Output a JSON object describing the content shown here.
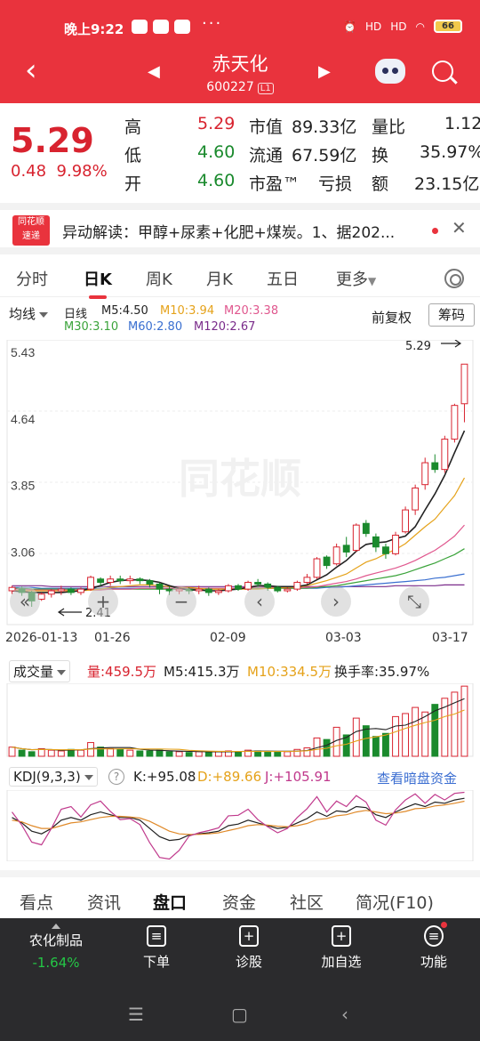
{
  "status_bar": {
    "time": "晚上9:22",
    "battery": "66",
    "signal_labels": [
      "HD",
      "HD"
    ]
  },
  "header": {
    "title": "赤天化",
    "code": "600227",
    "level": "L1"
  },
  "quote": {
    "price": "5.29",
    "change": "0.48",
    "change_pct": "9.98%",
    "rows": [
      {
        "k1": "高",
        "v1": "5.29",
        "k2": "市值",
        "v2": "89.33亿",
        "k3": "量比",
        "v3": "1.12"
      },
      {
        "k1": "低",
        "v1": "4.60",
        "k2": "流通",
        "v2": "67.59亿",
        "k3": "换",
        "v3": "35.97%"
      },
      {
        "k1": "开",
        "v1": "4.60",
        "k2": "市盈™",
        "v2": "亏损",
        "k3": "额",
        "v3": "23.15亿"
      }
    ],
    "colors": {
      "up": "#d8232f",
      "down": "#1a8a2d"
    }
  },
  "news": {
    "logo_top": "同花顺",
    "logo_bottom": "速递",
    "text": "异动解读：甲醇+尿素+化肥+煤炭。1、据202..."
  },
  "tabs": [
    "分时",
    "日K",
    "周K",
    "月K",
    "五日",
    "更多"
  ],
  "active_tab": "日K",
  "ma_legend": {
    "indicator": "均线",
    "period": "日线",
    "items": [
      {
        "label": "M5:4.50",
        "color": "#222222"
      },
      {
        "label": "M10:3.94",
        "color": "#e5a21a"
      },
      {
        "label": "M20:3.38",
        "color": "#e0578e"
      },
      {
        "label": "M30:3.10",
        "color": "#3aa33a"
      },
      {
        "label": "M60:2.80",
        "color": "#3a6fd0"
      },
      {
        "label": "M120:2.67",
        "color": "#7a2b8a"
      }
    ],
    "adjust": "前复权",
    "chip_button": "筹码"
  },
  "kline": {
    "watermark": "同花顺",
    "y_ticks": [
      "5.43",
      "4.64",
      "3.85",
      "3.06"
    ],
    "high_label": "5.29",
    "low_label": "2.41",
    "x_labels": [
      "2026-01-13",
      "01-26",
      "02-09",
      "03-03",
      "03-17"
    ]
  },
  "volume": {
    "name": "成交量",
    "vol": "量:459.5万",
    "m5": "M5:415.3万",
    "m10": "M10:334.5万",
    "turnover": "换手率:35.97%"
  },
  "kdj": {
    "name": "KDJ(9,3,3)",
    "help": "?",
    "k": "K:+95.08",
    "d": "D:+89.66",
    "j": "J:+105.91",
    "link": "查看暗盘资金"
  },
  "bottom_tabs": [
    "看点",
    "资讯",
    "盘口",
    "资金",
    "社区",
    "简况(F10)"
  ],
  "active_bottom_tab": "盘口",
  "dock": {
    "sector_name": "农化制品",
    "sector_pct": "-1.64%",
    "items": [
      {
        "label": "下单",
        "icon": "order-icon"
      },
      {
        "label": "诊股",
        "icon": "diagnose-icon"
      },
      {
        "label": "加自选",
        "icon": "add-watch-icon"
      },
      {
        "label": "功能",
        "icon": "menu-icon"
      }
    ]
  },
  "chart_data": [
    {
      "type": "candlestick",
      "title": "",
      "ylim": [
        2.41,
        5.43
      ],
      "y_ticks": [
        5.43,
        4.64,
        3.85,
        3.06
      ],
      "x_labels": [
        "2026-01-13",
        "01-26",
        "02-09",
        "03-03",
        "03-17"
      ],
      "candles": [
        [
          2.6,
          2.64,
          2.56,
          2.66
        ],
        [
          2.62,
          2.58,
          2.54,
          2.65
        ],
        [
          2.58,
          2.48,
          2.41,
          2.6
        ],
        [
          2.5,
          2.56,
          2.48,
          2.58
        ],
        [
          2.56,
          2.6,
          2.52,
          2.62
        ],
        [
          2.6,
          2.62,
          2.55,
          2.66
        ],
        [
          2.62,
          2.58,
          2.55,
          2.64
        ],
        [
          2.58,
          2.62,
          2.55,
          2.64
        ],
        [
          2.62,
          2.76,
          2.6,
          2.78
        ],
        [
          2.74,
          2.7,
          2.66,
          2.76
        ],
        [
          2.7,
          2.74,
          2.66,
          2.78
        ],
        [
          2.74,
          2.72,
          2.68,
          2.78
        ],
        [
          2.72,
          2.74,
          2.68,
          2.78
        ],
        [
          2.74,
          2.72,
          2.68,
          2.76
        ],
        [
          2.72,
          2.68,
          2.64,
          2.74
        ],
        [
          2.68,
          2.62,
          2.56,
          2.7
        ],
        [
          2.62,
          2.6,
          2.55,
          2.65
        ],
        [
          2.6,
          2.62,
          2.56,
          2.64
        ],
        [
          2.62,
          2.6,
          2.56,
          2.64
        ],
        [
          2.6,
          2.62,
          2.56,
          2.66
        ],
        [
          2.62,
          2.58,
          2.54,
          2.64
        ],
        [
          2.58,
          2.6,
          2.55,
          2.62
        ],
        [
          2.6,
          2.66,
          2.58,
          2.68
        ],
        [
          2.66,
          2.62,
          2.6,
          2.68
        ],
        [
          2.62,
          2.7,
          2.6,
          2.72
        ],
        [
          2.7,
          2.68,
          2.64,
          2.74
        ],
        [
          2.68,
          2.64,
          2.6,
          2.7
        ],
        [
          2.64,
          2.6,
          2.58,
          2.66
        ],
        [
          2.6,
          2.62,
          2.58,
          2.64
        ],
        [
          2.62,
          2.7,
          2.6,
          2.72
        ],
        [
          2.7,
          2.76,
          2.68,
          2.8
        ],
        [
          2.76,
          2.98,
          2.74,
          3.0
        ],
        [
          3.0,
          2.9,
          2.86,
          3.02
        ],
        [
          2.92,
          3.12,
          2.9,
          3.16
        ],
        [
          3.14,
          3.06,
          3.0,
          3.24
        ],
        [
          3.08,
          3.38,
          3.06,
          3.4
        ],
        [
          3.4,
          3.28,
          3.24,
          3.44
        ],
        [
          3.24,
          3.12,
          3.06,
          3.28
        ],
        [
          3.12,
          3.04,
          2.98,
          3.16
        ],
        [
          3.04,
          3.26,
          3.02,
          3.3
        ],
        [
          3.3,
          3.56,
          3.28,
          3.6
        ],
        [
          3.56,
          3.82,
          3.5,
          3.86
        ],
        [
          3.86,
          4.12,
          3.8,
          4.18
        ],
        [
          4.12,
          4.04,
          4.0,
          4.22
        ],
        [
          4.04,
          4.4,
          4.0,
          4.44
        ],
        [
          4.4,
          4.8,
          4.36,
          4.82
        ],
        [
          4.82,
          5.29,
          4.6,
          5.29
        ]
      ],
      "ma": {
        "M5": [
          2.6,
          2.59,
          2.58,
          2.58,
          2.58,
          2.58,
          2.59,
          2.6,
          2.63,
          2.66,
          2.7,
          2.72,
          2.73,
          2.73,
          2.72,
          2.7,
          2.66,
          2.63,
          2.61,
          2.61,
          2.6,
          2.6,
          2.61,
          2.62,
          2.64,
          2.66,
          2.66,
          2.65,
          2.65,
          2.65,
          2.67,
          2.73,
          2.79,
          2.88,
          2.96,
          3.07,
          3.15,
          3.17,
          3.18,
          3.22,
          3.25,
          3.36,
          3.56,
          3.75,
          3.97,
          4.24,
          4.5
        ],
        "M10": [
          2.61,
          2.6,
          2.6,
          2.6,
          2.6,
          2.6,
          2.6,
          2.6,
          2.61,
          2.62,
          2.64,
          2.65,
          2.66,
          2.67,
          2.67,
          2.66,
          2.65,
          2.64,
          2.64,
          2.63,
          2.62,
          2.62,
          2.62,
          2.62,
          2.62,
          2.62,
          2.63,
          2.63,
          2.64,
          2.64,
          2.66,
          2.69,
          2.72,
          2.76,
          2.8,
          2.87,
          2.94,
          2.98,
          3.04,
          3.09,
          3.16,
          3.26,
          3.36,
          3.45,
          3.59,
          3.73,
          3.94
        ],
        "M20": [
          2.62,
          2.62,
          2.61,
          2.61,
          2.61,
          2.61,
          2.61,
          2.61,
          2.61,
          2.61,
          2.62,
          2.62,
          2.62,
          2.63,
          2.63,
          2.63,
          2.63,
          2.63,
          2.63,
          2.63,
          2.63,
          2.63,
          2.63,
          2.63,
          2.64,
          2.64,
          2.64,
          2.64,
          2.64,
          2.64,
          2.64,
          2.65,
          2.67,
          2.69,
          2.71,
          2.74,
          2.78,
          2.81,
          2.84,
          2.87,
          2.91,
          2.96,
          3.02,
          3.08,
          3.16,
          3.25,
          3.38
        ],
        "M30": [
          2.63,
          2.63,
          2.62,
          2.62,
          2.62,
          2.62,
          2.62,
          2.62,
          2.62,
          2.62,
          2.62,
          2.62,
          2.62,
          2.62,
          2.62,
          2.62,
          2.62,
          2.62,
          2.62,
          2.62,
          2.62,
          2.62,
          2.62,
          2.62,
          2.63,
          2.63,
          2.63,
          2.63,
          2.63,
          2.63,
          2.63,
          2.64,
          2.65,
          2.66,
          2.68,
          2.7,
          2.72,
          2.74,
          2.76,
          2.78,
          2.81,
          2.85,
          2.89,
          2.93,
          2.98,
          3.03,
          3.1
        ],
        "M60": [
          2.64,
          2.64,
          2.64,
          2.63,
          2.63,
          2.63,
          2.63,
          2.63,
          2.63,
          2.63,
          2.63,
          2.63,
          2.63,
          2.63,
          2.63,
          2.63,
          2.63,
          2.63,
          2.63,
          2.63,
          2.63,
          2.63,
          2.63,
          2.63,
          2.63,
          2.63,
          2.63,
          2.63,
          2.63,
          2.63,
          2.63,
          2.63,
          2.64,
          2.64,
          2.65,
          2.66,
          2.67,
          2.68,
          2.69,
          2.7,
          2.71,
          2.72,
          2.73,
          2.75,
          2.76,
          2.78,
          2.8
        ],
        "M120": [
          2.66,
          2.66,
          2.66,
          2.66,
          2.65,
          2.65,
          2.65,
          2.65,
          2.65,
          2.65,
          2.65,
          2.65,
          2.65,
          2.65,
          2.65,
          2.65,
          2.65,
          2.65,
          2.65,
          2.65,
          2.65,
          2.65,
          2.65,
          2.65,
          2.65,
          2.65,
          2.65,
          2.65,
          2.65,
          2.65,
          2.65,
          2.65,
          2.65,
          2.65,
          2.65,
          2.65,
          2.65,
          2.65,
          2.65,
          2.66,
          2.66,
          2.66,
          2.66,
          2.66,
          2.67,
          2.67,
          2.67
        ]
      }
    },
    {
      "type": "bar",
      "name": "成交量",
      "values": [
        60,
        40,
        30,
        50,
        40,
        35,
        45,
        40,
        90,
        60,
        50,
        45,
        40,
        35,
        35,
        40,
        30,
        30,
        25,
        30,
        30,
        30,
        35,
        30,
        40,
        35,
        30,
        30,
        30,
        45,
        55,
        120,
        110,
        190,
        140,
        250,
        200,
        130,
        150,
        260,
        280,
        320,
        290,
        340,
        380,
        420,
        459.5
      ]
    },
    {
      "type": "line",
      "name": "KDJ(9,3,3)",
      "series": [
        {
          "name": "K",
          "values": [
            60,
            50,
            35,
            30,
            40,
            55,
            60,
            55,
            65,
            70,
            65,
            60,
            60,
            55,
            40,
            25,
            18,
            20,
            28,
            30,
            32,
            35,
            45,
            48,
            55,
            50,
            45,
            40,
            42,
            50,
            58,
            70,
            62,
            72,
            70,
            80,
            78,
            65,
            60,
            70,
            78,
            85,
            80,
            88,
            86,
            92,
            95.08
          ]
        },
        {
          "name": "D",
          "values": [
            55,
            52,
            45,
            40,
            40,
            45,
            50,
            52,
            56,
            60,
            62,
            62,
            61,
            59,
            53,
            44,
            35,
            30,
            29,
            29,
            30,
            32,
            36,
            40,
            45,
            47,
            46,
            44,
            43,
            45,
            49,
            56,
            58,
            63,
            65,
            70,
            73,
            70,
            67,
            68,
            71,
            76,
            77,
            81,
            83,
            86,
            89.66
          ]
        },
        {
          "name": "J",
          "values": [
            70,
            46,
            15,
            10,
            40,
            75,
            80,
            61,
            83,
            90,
            71,
            56,
            58,
            47,
            14,
            -13,
            -16,
            0,
            26,
            32,
            36,
            41,
            63,
            64,
            75,
            56,
            43,
            32,
            40,
            60,
            76,
            98,
            70,
            90,
            80,
            100,
            88,
            55,
            46,
            74,
            92,
            103,
            86,
            102,
            92,
            104,
            105.91
          ]
        }
      ]
    }
  ]
}
